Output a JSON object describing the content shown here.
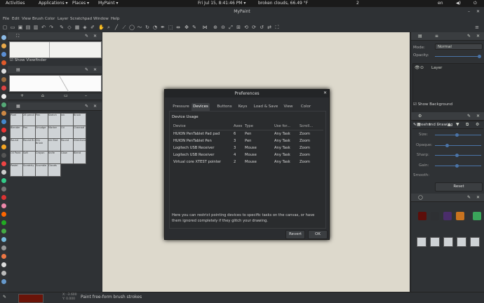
{
  "topbar": {
    "activities": "Activities",
    "applications": "Applications ▾",
    "places": "Places ▾",
    "app": "MyPaint ▾",
    "clock": "Fri Jul 15,  8:41:46 PM ▾",
    "weather": "broken clouds, 66.49 °F",
    "workspace": "2",
    "lang": "en"
  },
  "window": {
    "title": "MyPaint"
  },
  "menu": [
    "File",
    "Edit",
    "View",
    "Brush",
    "Color",
    "Layer",
    "Scratchpad",
    "Window",
    "Help"
  ],
  "left": {
    "show_viewfinder": "Show Viewfinder",
    "brushes": [
      [
        "Pixel",
        "2B pencil",
        "Pen",
        "Sketch",
        "Ink",
        "Brush"
      ],
      [
        "Blender",
        "Pen",
        "Smudge",
        "Marker",
        "Oil",
        "Charcoal"
      ],
      [
        "Round",
        "Round Br.",
        "Dry Brush",
        "Ink Blot",
        "Round",
        "Directions"
      ],
      [
        "Oil Paint",
        "Soft",
        "Crayon",
        "Knife",
        "Glow",
        "Blend"
      ],
      [
        "Pastel",
        "Scratchy",
        "Scumble",
        "Clouds",
        "",
        ""
      ]
    ]
  },
  "dialog": {
    "title": "Preferences",
    "tabs": [
      "Pressure",
      "Devices",
      "Buttons",
      "Keys",
      "Load & Save",
      "View",
      "Color"
    ],
    "section": "Device Usage",
    "columns": [
      "Device",
      "Axes",
      "Type",
      "Use for...",
      "Scroll..."
    ],
    "rows": [
      [
        "HUION PenTablet Pad pad",
        "6",
        "Pen",
        "Any Task",
        "Zoom"
      ],
      [
        "HUION PenTablet Pen",
        "3",
        "Pen",
        "Any Task",
        "Zoom"
      ],
      [
        "Logitech USB Receiver",
        "3",
        "Mouse",
        "Any Task",
        "Zoom"
      ],
      [
        "Logitech USB Receiver",
        "4",
        "Mouse",
        "Any Task",
        "Zoom"
      ],
      [
        "Virtual core XTEST pointer",
        "2",
        "Mouse",
        "Any Task",
        "Zoom"
      ]
    ],
    "help": "Here you can restrict pointing devices to specific tasks on the canvas, or have them ignored completely if they glitch your drawing.",
    "revert": "Revert",
    "ok": "OK"
  },
  "right": {
    "mode_label": "Mode:",
    "mode_value": "Normal",
    "opacity_label": "Opacity:",
    "layer": "Layer",
    "show_background": "Show Background",
    "brush_name": "Freehand Drawing",
    "size": "Size:",
    "opaque": "Opaque:",
    "sharp": "Sharp:",
    "gain": "Gain:",
    "smooth": "Smooth:",
    "reset": "Reset"
  },
  "swatches": [
    "#5c0e0a",
    "#2e3033",
    "#4a2d6a",
    "#c9731f",
    "#3aa55a"
  ],
  "status": {
    "line1": "X: -3.600",
    "line2": "Y: 0.000",
    "hint": "Paint free-form brush strokes",
    "color": "#6a1409"
  }
}
